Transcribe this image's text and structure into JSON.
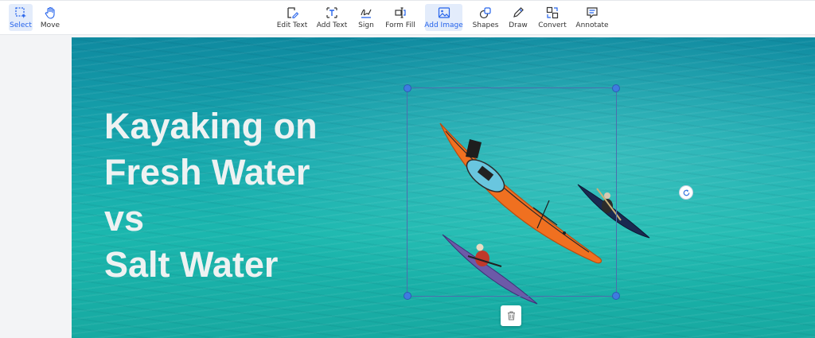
{
  "toolbar": {
    "left_tools": [
      {
        "label": "Select",
        "icon": "select-icon",
        "active": true
      },
      {
        "label": "Move",
        "icon": "hand-icon",
        "active": false
      }
    ],
    "tools": [
      {
        "label": "Edit Text",
        "icon": "edit-text-icon"
      },
      {
        "label": "Add Text",
        "icon": "add-text-icon"
      },
      {
        "label": "Sign",
        "icon": "signature-icon"
      },
      {
        "label": "Form Fill",
        "icon": "form-fill-icon"
      },
      {
        "label": "Add Image",
        "icon": "image-icon",
        "active": true
      },
      {
        "label": "Shapes",
        "icon": "shapes-icon"
      },
      {
        "label": "Draw",
        "icon": "pen-icon"
      },
      {
        "label": "Convert",
        "icon": "convert-icon"
      },
      {
        "label": "Annotate",
        "icon": "comment-icon"
      }
    ],
    "accent_color": "#2563eb",
    "active_bg": "#e3ecfb"
  },
  "document": {
    "headline_lines": [
      "Kayaking on",
      "Fresh Water",
      "vs",
      "Salt Water"
    ],
    "headline_color": "#eef2f2",
    "background": "turquoise sea photo with kayakers",
    "selected_image": "orange kayak",
    "selection_color": "#3f7be0"
  },
  "controls": {
    "rotate_icon": "rotate-icon",
    "delete_icon": "trash-icon"
  }
}
